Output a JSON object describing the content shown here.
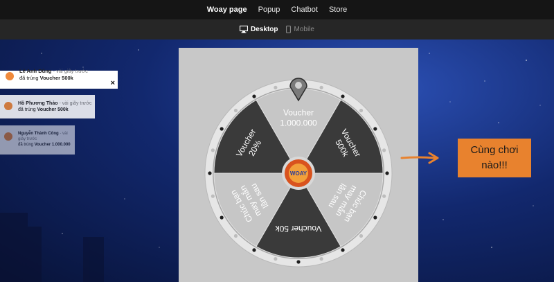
{
  "nav": {
    "items": [
      "Woay page",
      "Popup",
      "Chatbot",
      "Store"
    ],
    "active": 0
  },
  "device": {
    "desktop": "Desktop",
    "mobile": "Mobile"
  },
  "notifications": [
    {
      "name": "Lê Anh Dũng",
      "ago": "- vài giây trước",
      "text": "đã trúng",
      "voucher": "Voucher 500k"
    },
    {
      "name": "Hồ Phương Thảo",
      "ago": "- vài giây trước",
      "text": "đã trúng",
      "voucher": "Voucher 500k"
    },
    {
      "name": "Nguyễn Thành Công",
      "ago": "- vài giây trước",
      "text": "đã trúng",
      "voucher": "Voucher 1.000.000"
    }
  ],
  "close_label": "×",
  "wheel": {
    "segments": [
      {
        "lines": [
          "Voucher",
          "1.000.000"
        ],
        "color": "#c6c6c6",
        "text_color": "#ffffff"
      },
      {
        "lines": [
          "Voucher",
          "500k"
        ],
        "color": "#3a3a3a",
        "text_color": "#ffffff"
      },
      {
        "lines": [
          "Chúc bạn",
          "may mắn",
          "lần sau"
        ],
        "color": "#c6c6c6",
        "text_color": "#ffffff"
      },
      {
        "lines": [
          "Voucher 50k"
        ],
        "color": "#3a3a3a",
        "text_color": "#ffffff"
      },
      {
        "lines": [
          "Chúc bạn",
          "may mắn",
          "lần sau"
        ],
        "color": "#c6c6c6",
        "text_color": "#ffffff"
      },
      {
        "lines": [
          "Voucher",
          "20%"
        ],
        "color": "#3a3a3a",
        "text_color": "#ffffff"
      }
    ],
    "center_label": "WOAY"
  },
  "cta": {
    "line1": "Cùng chơi",
    "line2": "nào!!!"
  },
  "colors": {
    "accent": "#e8822e",
    "topbar": "#151515",
    "devbar": "#262626"
  }
}
